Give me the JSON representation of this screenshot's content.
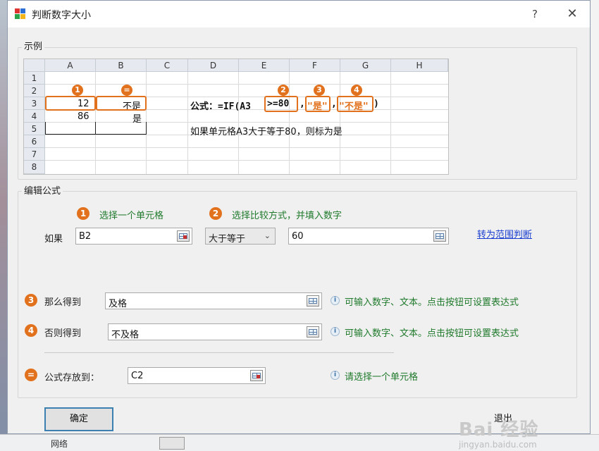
{
  "window": {
    "title": "判断数字大小",
    "help_glyph": "?",
    "close_glyph": "✕"
  },
  "example": {
    "group_title": "示例",
    "columns": [
      "A",
      "B",
      "C",
      "D",
      "E",
      "F",
      "G",
      "H"
    ],
    "rows": [
      "1",
      "2",
      "3",
      "4",
      "5",
      "6",
      "7",
      "8"
    ],
    "cells": {
      "a3": "12",
      "b3": "不是",
      "a4": "86",
      "b4": "是"
    },
    "badges": {
      "one": "1",
      "equals": "=",
      "two": "2",
      "three": "3",
      "four": "4"
    },
    "formula": {
      "prefix": "公式：=IF(A3",
      "cond": ">=80",
      "comma1": ",",
      "yes": "\"是\"",
      "comma2": ",",
      "no": "\"不是\"",
      "suffix": ")"
    },
    "explanation": "如果单元格A3大于等于80，则标为是"
  },
  "editor": {
    "group_title": "编辑公式",
    "step1_badge": "1",
    "step1_hint": "选择一个单元格",
    "step2_badge": "2",
    "step2_hint": "选择比较方式，并填入数字",
    "if_label": "如果",
    "cell_value": "B2",
    "compare_selected": "大于等于",
    "compare_value": "60",
    "range_link": "转为范围判断",
    "then_badge": "3",
    "then_label": "那么得到",
    "then_value": "及格",
    "then_hint": "可输入数字、文本。点击按钮可设置表达式",
    "else_badge": "4",
    "else_label": "否则得到",
    "else_value": "不及格",
    "else_hint": "可输入数字、文本。点击按钮可设置表达式",
    "store_badge": "=",
    "store_label": "公式存放到：",
    "store_value": "C2",
    "store_hint": "请选择一个单元格",
    "info_glyph": "i"
  },
  "buttons": {
    "ok": "确定",
    "exit": "退出"
  },
  "watermark": {
    "brand": "Bai 经验",
    "site": "jingyan.baidu.com"
  },
  "background": {
    "tree_item": "网络"
  },
  "colors": {
    "accent": "#e2711d",
    "hint_green": "#1f7a2c",
    "link": "#1a3ecf"
  }
}
